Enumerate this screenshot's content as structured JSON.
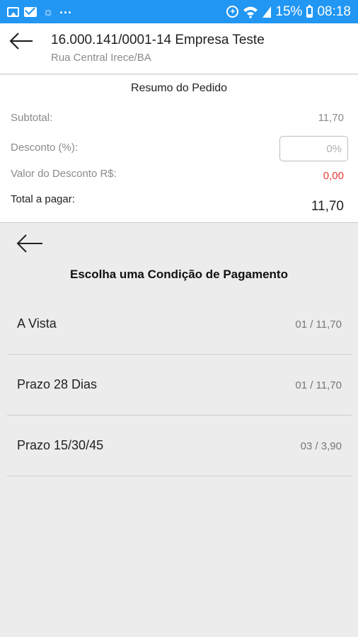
{
  "status_bar": {
    "dots": "...",
    "battery": "15%",
    "time": "08:18"
  },
  "header": {
    "title": "16.000.141/0001-14 Empresa Teste",
    "subtitle": "Rua Central Irece/BA"
  },
  "summary": {
    "title": "Resumo do Pedido",
    "subtotal_label": "Subtotal:",
    "subtotal_value": "11,70",
    "discount_label": "Desconto (%):",
    "discount_placeholder": "0%",
    "discount_value_label": "Valor do Desconto R$:",
    "discount_value": "0,00",
    "total_label": "Total a pagar:",
    "total_value": "11,70"
  },
  "payment": {
    "title": "Escolha uma Condição de Pagamento",
    "options": [
      {
        "name": "A Vista",
        "installments": "01 / 11,70"
      },
      {
        "name": "Prazo 28 Dias",
        "installments": "01 / 11,70"
      },
      {
        "name": "Prazo 15/30/45",
        "installments": "03 / 3,90"
      }
    ]
  },
  "icons": {
    "back": "arrow-left-icon",
    "accent_color": "#2196f3",
    "discount_value_color": "#e53935"
  }
}
